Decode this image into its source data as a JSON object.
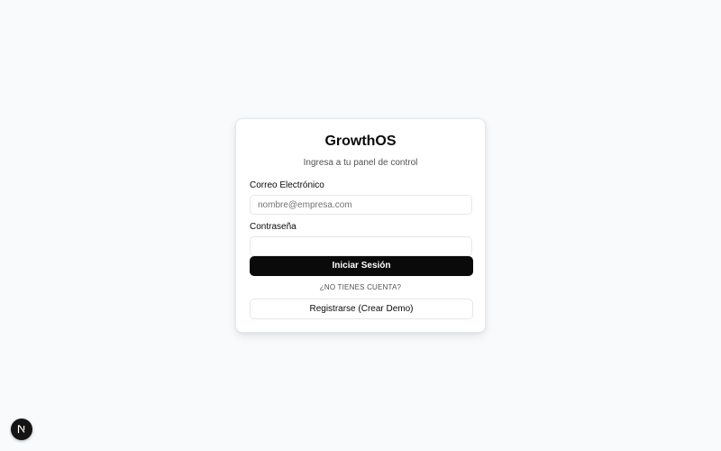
{
  "login_card": {
    "title": "GrowthOS",
    "subtitle": "Ingresa a tu panel de control",
    "email_label": "Correo Electrónico",
    "email_placeholder": "nombre@empresa.com",
    "email_value": "",
    "password_label": "Contraseña",
    "password_value": "",
    "submit_label": "Iniciar Sesión",
    "no_account_text": "¿NO TIENES CUENTA?",
    "register_label": "Registrarse (Crear Demo)"
  },
  "dev_badge": {
    "icon": "nextjs-logo-icon",
    "letter": "N"
  },
  "colors": {
    "background": "#f8fafc",
    "card": "#ffffff",
    "primary_button": "#0a0a0a",
    "border": "#e5e7eb",
    "badge": "#141414"
  }
}
